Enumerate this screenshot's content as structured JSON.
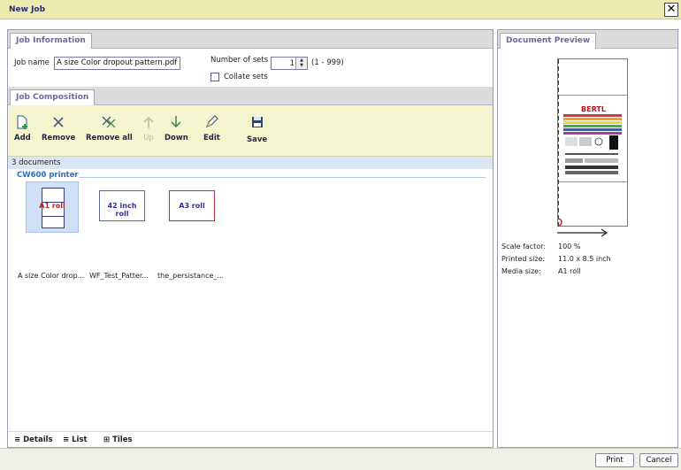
{
  "window": {
    "title": "New Job",
    "close_glyph": "✕"
  },
  "job_information": {
    "tab_label": "Job Information",
    "job_name_label": "Job name",
    "job_name_value": "A size Color dropout pattern.pdf",
    "number_of_sets_label": "Number of sets",
    "number_of_sets_value": "1",
    "number_of_sets_range": "(1 - 999)",
    "collate_label": "Collate sets",
    "collate_checked": false
  },
  "job_composition": {
    "tab_label": "Job Composition",
    "toolbar": [
      {
        "id": "add",
        "label": "Add",
        "icon": "add-document-icon",
        "enabled": true
      },
      {
        "id": "remove",
        "label": "Remove",
        "icon": "remove-x-icon",
        "enabled": true
      },
      {
        "id": "remove-all",
        "label": "Remove all",
        "icon": "remove-all-icon",
        "enabled": true
      },
      {
        "id": "up",
        "label": "Up",
        "icon": "arrow-up-icon",
        "enabled": false
      },
      {
        "id": "down",
        "label": "Down",
        "icon": "arrow-down-icon",
        "enabled": true
      },
      {
        "id": "edit",
        "label": "Edit",
        "icon": "pencil-icon",
        "enabled": true
      },
      {
        "id": "save",
        "label": "Save",
        "icon": "floppy-disk-icon",
        "enabled": true
      }
    ],
    "document_count": "3 documents",
    "printer_name": "CW600 printer",
    "documents": [
      {
        "thumb_label": "A1 roll",
        "caption": "A size Color drop...",
        "selected": true
      },
      {
        "thumb_label": "42 inch roll",
        "caption": "WF_Test_Patter...",
        "selected": false
      },
      {
        "thumb_label": "A3 roll",
        "caption": "the_persistance_...",
        "selected": false
      }
    ],
    "view_options": [
      {
        "label": "Details",
        "icon": "details-view-icon",
        "active": true
      },
      {
        "label": "List",
        "icon": "list-view-icon",
        "active": true
      },
      {
        "label": "Tiles",
        "icon": "tiles-view-icon",
        "active": false
      }
    ]
  },
  "document_preview": {
    "tab_label": "Document Preview",
    "thumbnail_brand": "BERTL",
    "scale_factor_label": "Scale factor:",
    "scale_factor_value": "100 %",
    "printed_size_label": "Printed size:",
    "printed_size_value": "11.0 x 8.5 inch",
    "media_size_label": "Media size:",
    "media_size_value": "A1 roll"
  },
  "footer": {
    "print_label": "Print",
    "cancel_label": "Cancel"
  },
  "colors": {
    "titlebar": "#ebebb0",
    "toolbar": "#f4f4cf",
    "link_blue": "#2d6cc0",
    "selection": "#cfe0f7"
  }
}
